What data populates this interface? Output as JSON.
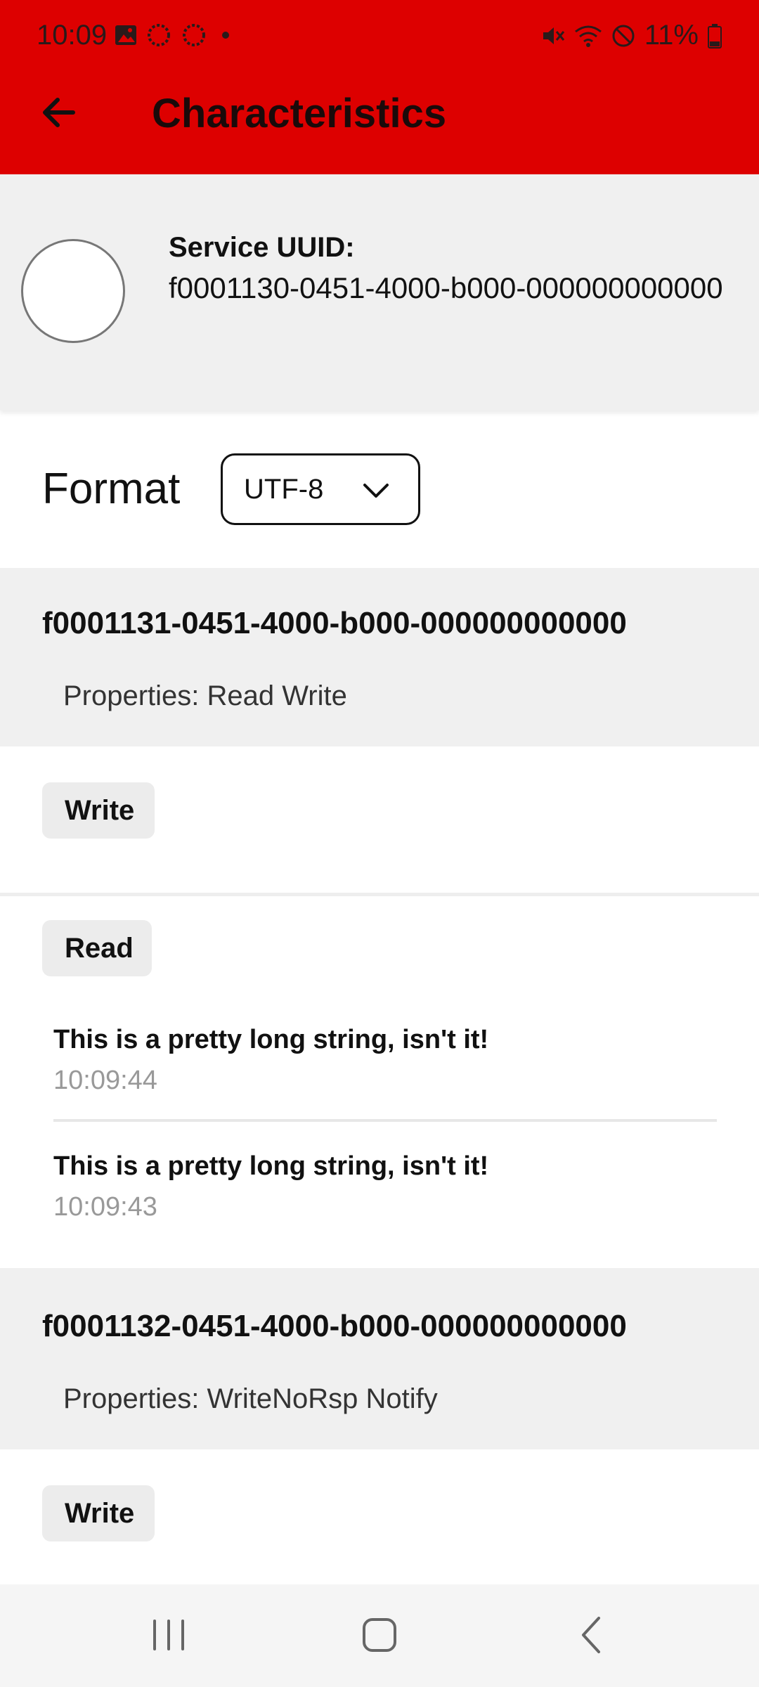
{
  "status": {
    "time": "10:09",
    "battery": "11%"
  },
  "appbar": {
    "title": "Characteristics"
  },
  "service": {
    "label": "Service UUID:",
    "uuid": "f0001130-0451-4000-b000-000000000000"
  },
  "format": {
    "label": "Format",
    "selected": "UTF-8"
  },
  "characteristics": [
    {
      "uuid": "f0001131-0451-4000-b000-000000000000",
      "properties": "Properties: Read Write",
      "write_label": "Write",
      "read_label": "Read",
      "reads": [
        {
          "value": "This is a pretty long string, isn't it!",
          "time": "10:09:44"
        },
        {
          "value": "This is a pretty long string, isn't it!",
          "time": "10:09:43"
        }
      ]
    },
    {
      "uuid": "f0001132-0451-4000-b000-000000000000",
      "properties": "Properties: WriteNoRsp Notify",
      "write_label": "Write"
    }
  ],
  "colors": {
    "accent": "#dd0000",
    "panel": "#f0f0f0"
  }
}
